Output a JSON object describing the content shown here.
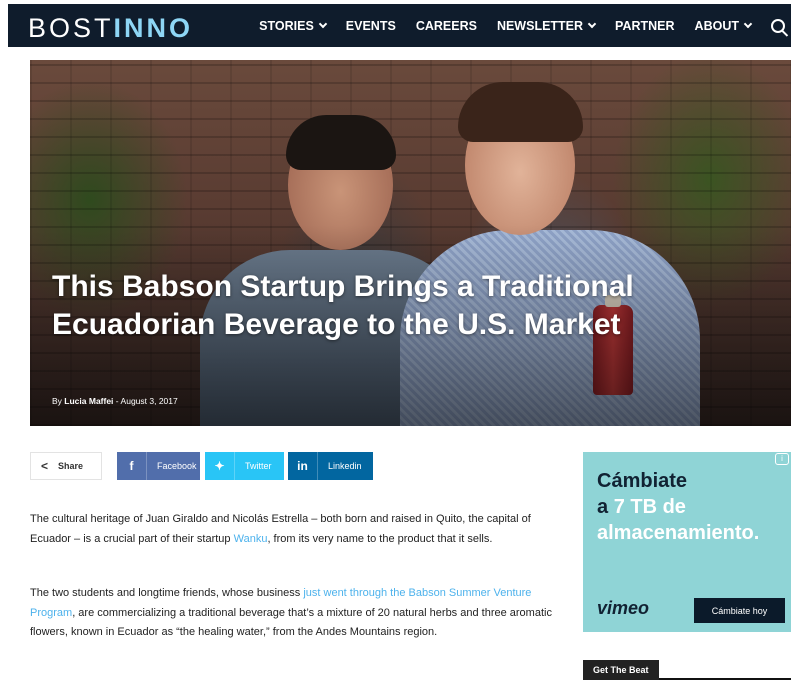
{
  "header": {
    "logo_a": "BOST",
    "logo_b": "INNO",
    "nav": [
      "STORIES",
      "EVENTS",
      "CAREERS",
      "NEWSLETTER",
      "PARTNER",
      "ABOUT"
    ],
    "icons": {
      "search": "search-icon",
      "chevron": "chevron-down-icon"
    }
  },
  "hero": {
    "title": "This Babson Startup Brings a Traditional Ecuadorian Beverage to the U.S. Market",
    "by": "By",
    "author": "Lucia Maffei",
    "separator": "-",
    "date": "August 3, 2017"
  },
  "share": {
    "label": "Share",
    "facebook": "Facebook",
    "twitter": "Twitter",
    "linkedin": "Linkedin"
  },
  "article": {
    "p1_a": "The cultural heritage of Juan Giraldo and Nicolás Estrella – both born and raised in Quito, the capital of Ecuador – is a crucial part of their startup ",
    "p1_link": "Wanku",
    "p1_b": ", from its very name to the product that it sells.",
    "p2_a": "The two students and longtime friends, whose business ",
    "p2_link": "just went through the Babson Summer Venture Program",
    "p2_b": ", are commercializing a traditional beverage that’s a mixture of 20 natural herbs and three aromatic flowers, known in Ecuador as “the healing water,” from the Andes Mountains region."
  },
  "ad": {
    "line1": "Cámbiate",
    "line2a": "a ",
    "line2b": "7 TB de",
    "line3": "almacenamiento.",
    "brand": "vimeo",
    "cta": "Cámbiate hoy",
    "info": "i"
  },
  "sidebar": {
    "beat_label": "Get The Beat"
  },
  "colors": {
    "nav_bg": "#0f1c2c",
    "logo_accent": "#8ed6f5",
    "link": "#4db2ec",
    "facebook": "#516eab",
    "twitter": "#29c5f6",
    "linkedin": "#0266a0",
    "ad_bg": "#8fd4d6"
  }
}
